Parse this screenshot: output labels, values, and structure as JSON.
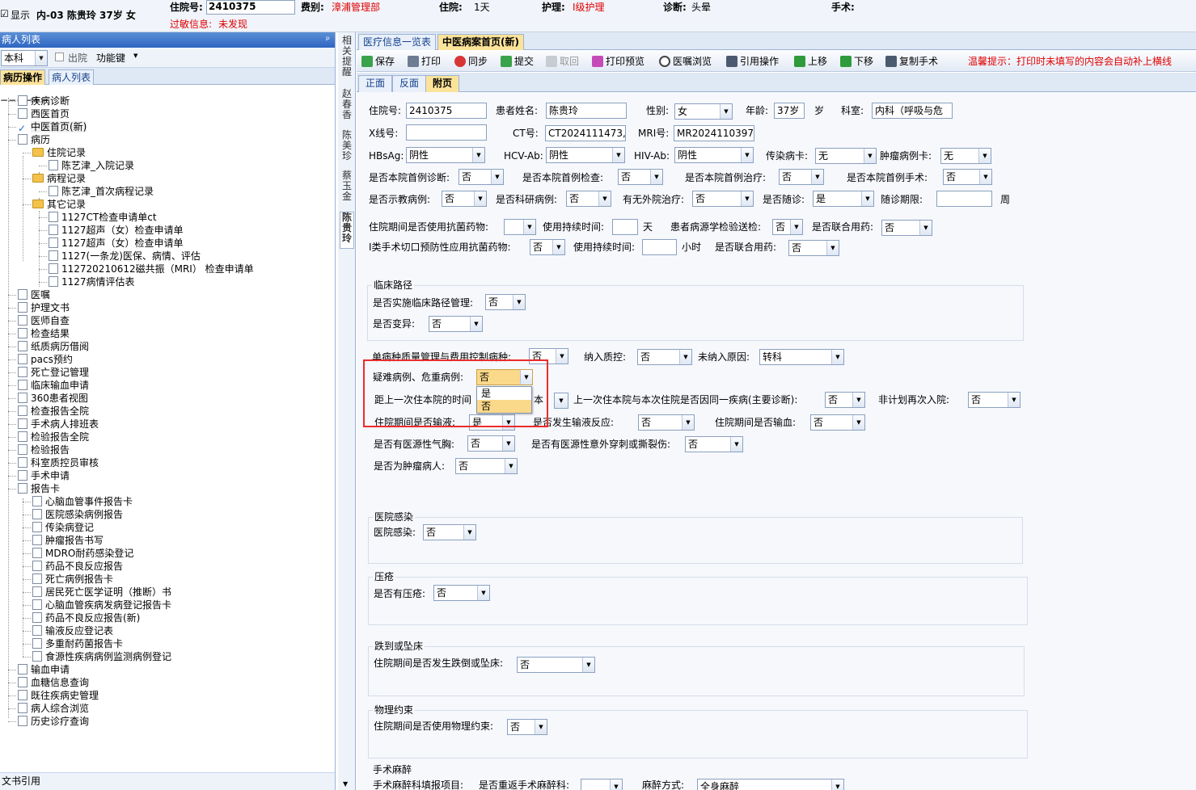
{
  "topbar": {
    "show_label": "显示",
    "patient_summary": "内-03  陈贵玲 37岁 女",
    "admit_no_label": "住院号:",
    "admit_no": "2410375",
    "allergy_label": "过敏信息:",
    "allergy_value": "未发现",
    "category_label": "费别:",
    "category_value": "漳浦管理部",
    "stay_label": "住院:",
    "stay_value": "1天",
    "care_label": "护理:",
    "care_value": "I级护理",
    "diag_label": "诊断:",
    "diag_value": "头晕",
    "surgery_label": "手术:"
  },
  "left_panel": {
    "title": "病人列表",
    "pin": "ᵖ",
    "dept_select": "本科",
    "discharged_label": "出院",
    "func_key_label": "功能键",
    "tab_active": "病历操作",
    "tab_other": "病人列表",
    "footer": "文书引用",
    "tree": [
      "疾病诊断",
      "西医首页",
      "中医首页(新)",
      "病历",
      "住院记录",
      "陈艺津_入院记录",
      "病程记录",
      "陈艺津_首次病程记录",
      "其它记录",
      "1127CT检查申请单ct",
      "1127超声（女）检查申请单",
      "1127超声（女）检查申请单",
      "1127(一条龙)医保、病情、评估",
      "112720210612磁共振（MRI） 检查申请单",
      "1127病情评估表",
      "医嘱",
      "护理文书",
      "医师自查",
      "检查结果",
      "纸质病历借阅",
      "pacs预约",
      "死亡登记管理",
      "临床输血申请",
      "360患者视图",
      "检查报告全院",
      "手术病人排班表",
      "检验报告全院",
      "检验报告",
      "科室质控员审核",
      "手术申请",
      "报告卡",
      "心脑血管事件报告卡",
      "医院感染病例报告",
      "传染病登记",
      "肿瘤报告书写",
      "MDRO耐药感染登记",
      "药品不良反应报告",
      "死亡病例报告卡",
      "居民死亡医学证明（推断）书",
      "心脑血管疾病发病登记报告卡",
      "药品不良反应报告(新)",
      "输液反应登记表",
      "多重耐药菌报告卡",
      "食源性疾病病例监测病例登记",
      "输血申请",
      "血糖信息查询",
      "既往疾病史管理",
      "病人综合浏览",
      "历史诊疗查询"
    ]
  },
  "vertical_tabs": [
    "相关提醒",
    "赵春香",
    "陈美珍",
    "蔡玉金",
    "陈贵玲"
  ],
  "doc_tabs": [
    "医疗信息一览表",
    "中医病案首页(新)"
  ],
  "toolbar": {
    "buttons": [
      "保存",
      "打印",
      "同步",
      "提交",
      "取回",
      "打印预览",
      "医嘱浏览",
      "引用操作",
      "上移",
      "下移",
      "复制手术"
    ],
    "hint": "温馨提示：打印时未填写的内容会自动补上横线"
  },
  "sub_tabs": [
    "正面",
    "反面",
    "附页"
  ],
  "form": {
    "admit_no_label": "住院号:",
    "admit_no": "2410375",
    "name_label": "患者姓名:",
    "name": "陈贵玲",
    "sex_label": "性别:",
    "sex": "女",
    "age_label": "年龄:",
    "age": "37岁",
    "age_unit": "岁",
    "dept_label": "科室:",
    "dept": "内科（呼吸与危",
    "xray_label": "X线号:",
    "xray": "",
    "ct_label": "CT号:",
    "ct": "CT2024111473,C",
    "mri_label": "MRI号:",
    "mri": "MR2024110397",
    "hbsag_label": "HBsAg:",
    "hbsag": "阴性",
    "hcv_label": "HCV-Ab:",
    "hcv": "阴性",
    "hiv_label": "HIV-Ab:",
    "hiv": "阴性",
    "infect_label": "传染病卡:",
    "infect": "无",
    "tumor_card_label": "肿瘤病例卡:",
    "tumor_card": "无",
    "first_diag_label": "是否本院首例诊断:",
    "first_diag": "否",
    "first_exam_label": "是否本院首例检查:",
    "first_exam": "否",
    "first_treat_label": "是否本院首例治疗:",
    "first_treat": "否",
    "first_surg_label": "是否本院首例手术:",
    "first_surg": "否",
    "teach_label": "是否示教病例:",
    "teach": "否",
    "research_label": "是否科研病例:",
    "research": "否",
    "outside_label": "有无外院治疗:",
    "outside": "否",
    "followup_label": "是否随诊:",
    "followup": "是",
    "followup_period_label": "随诊期限:",
    "followup_period": "",
    "followup_unit": "周",
    "antibiotic_label": "住院期间是否使用抗菌药物:",
    "antibiotic": "",
    "duration_label": "使用持续时间:",
    "duration": "",
    "day_unit": "天",
    "micro_label": "患者病源学检验送检:",
    "micro": "否",
    "combo_label": "是否联合用药:",
    "combo": "否",
    "incision_label": "I类手术切口预防性应用抗菌药物:",
    "incision": "否",
    "duration2_label": "使用持续时间:",
    "duration2": "",
    "hour_unit": "小时",
    "combo2_label": "是否联合用药:",
    "combo2": "否",
    "clinical_path_title": "临床路径",
    "cp_impl_label": "是否实施临床路径管理:",
    "cp_impl": "否",
    "cp_var_label": "是否变异:",
    "cp_var": "否",
    "single_disease_label": "单病种质量管理与费用控制病种:",
    "single_disease": "否",
    "qc_label": "纳入质控:",
    "qc": "否",
    "not_in_label": "未纳入原因:",
    "not_in": "转科",
    "critical_label": "疑难病例、危重病例:",
    "critical": "否",
    "critical_options": [
      "是",
      "否"
    ],
    "last_admit_label": "距上一次住本院的时间",
    "last_admit_unit": "本",
    "same_disease_label": "上一次住本院与本次住院是否因同一疾病(主要诊断):",
    "same_disease": "否",
    "unplanned_label": "非计划再次入院:",
    "unplanned": "否",
    "infusion_label": "住院期间是否输液:",
    "infusion": "是",
    "infusion_react_label": "是否发生输液反应:",
    "infusion_react": "否",
    "transfusion_label": "住院期间是否输血:",
    "transfusion": "否",
    "pneumo_label": "是否有医源性气胸:",
    "pneumo": "否",
    "puncture_label": "是否有医源性意外穿刺或撕裂伤:",
    "puncture": "否",
    "tumor_label": "是否为肿瘤病人:",
    "tumor": "否",
    "hosp_infect_title": "医院感染",
    "hosp_infect_label": "医院感染:",
    "hosp_infect": "否",
    "pressure_title": "压疮",
    "pressure_label": "是否有压疮:",
    "pressure": "否",
    "fall_title": "跌到或坠床",
    "fall_label": "住院期间是否发生跌倒或坠床:",
    "fall": "否",
    "restraint_title": "物理约束",
    "restraint_label": "住院期间是否使用物理约束:",
    "restraint": "否",
    "anesthesia_title": "手术麻醉",
    "anes_fill_label": "手术麻醉科填报项目:",
    "anes_fill": "",
    "anes_major_label": "是否重返手术麻醉科:",
    "anes_major": "",
    "anes_method_label": "麻醉方式:",
    "anes_method": "全身麻醉"
  }
}
